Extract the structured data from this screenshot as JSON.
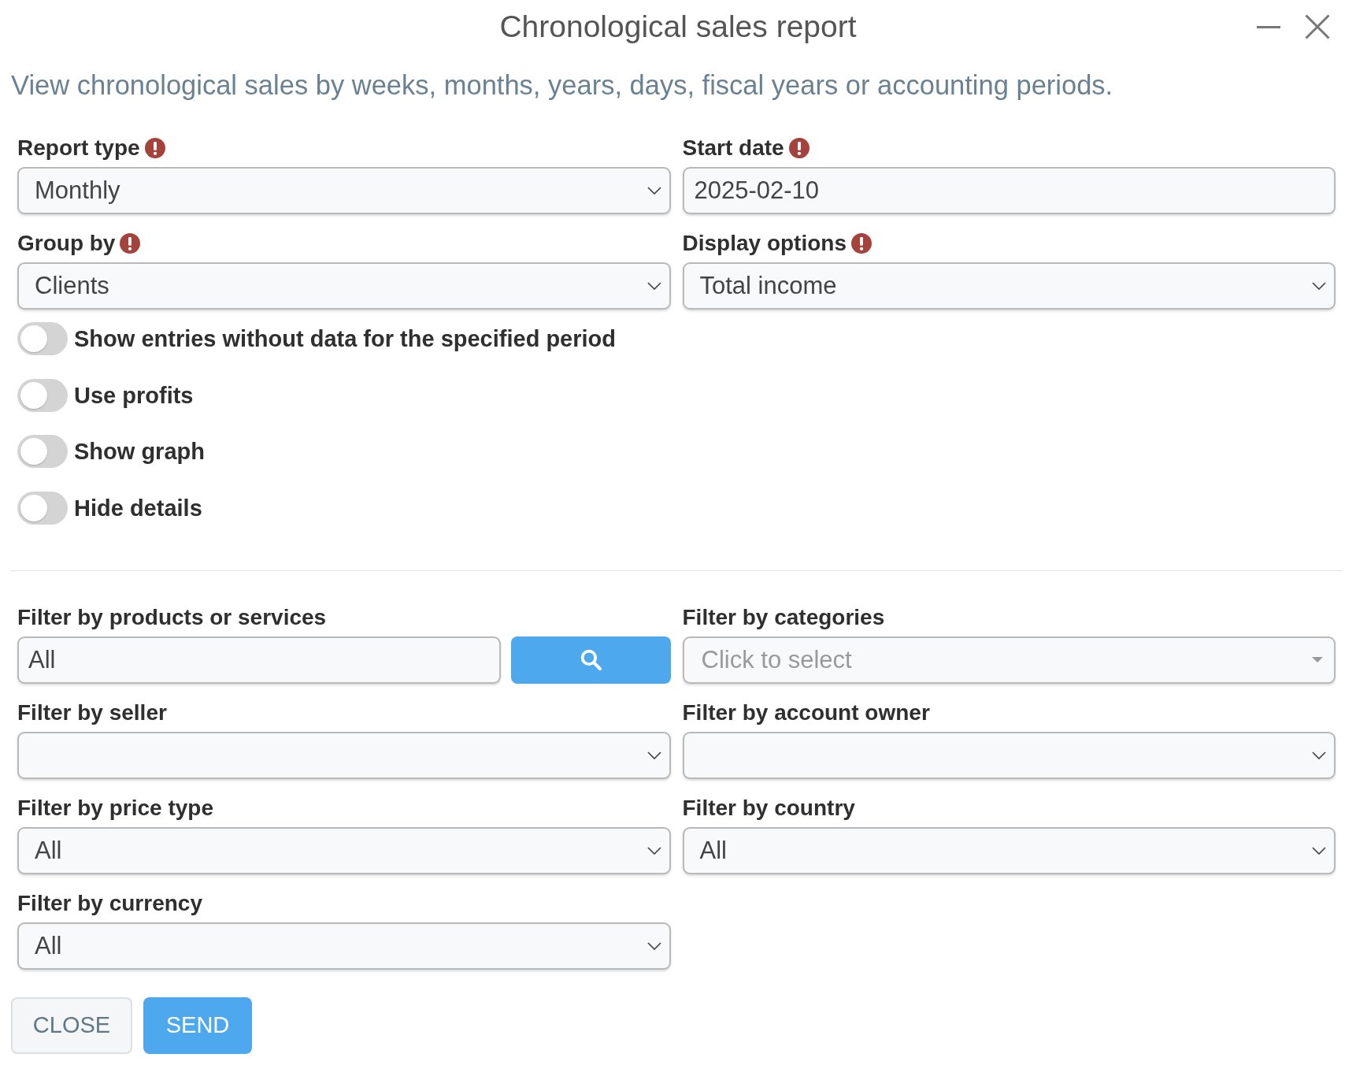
{
  "window": {
    "title": "Chronological sales report"
  },
  "description": "View chronological sales by weeks, months, years, days, fiscal years or accounting periods.",
  "fields": [
    {
      "kind": "select",
      "label": "Report type",
      "required": true,
      "value": "Monthly"
    },
    {
      "kind": "date",
      "label": "Start date",
      "required": true,
      "value": "2025-02-10"
    },
    {
      "kind": "select",
      "label": "Group by",
      "required": true,
      "value": "Clients"
    },
    {
      "kind": "select",
      "label": "Display options",
      "required": true,
      "value": "Total income"
    }
  ],
  "toggles": [
    {
      "label": "Show entries without data for the specified period",
      "on": false
    },
    {
      "label": "Use profits",
      "on": false
    },
    {
      "label": "Show graph",
      "on": false
    },
    {
      "label": "Hide details",
      "on": false
    }
  ],
  "filters": [
    {
      "kind": "search",
      "label": "Filter by products or services",
      "required": false,
      "value": "All"
    },
    {
      "kind": "multiselect",
      "label": "Filter by categories",
      "required": false,
      "placeholder": "Click to select"
    },
    {
      "kind": "select",
      "label": "Filter by seller",
      "required": false
    },
    {
      "kind": "select",
      "label": "Filter by account owner",
      "required": false
    },
    {
      "kind": "select",
      "label": "Filter by price type",
      "required": false,
      "value": "All"
    },
    {
      "kind": "select",
      "label": "Filter by country",
      "required": false,
      "value": "All"
    },
    {
      "kind": "select",
      "label": "Filter by currency",
      "required": false,
      "value": "All"
    }
  ],
  "buttons": [
    {
      "kind": "secondary",
      "label": "CLOSE"
    },
    {
      "kind": "primary",
      "label": "SEND"
    }
  ]
}
